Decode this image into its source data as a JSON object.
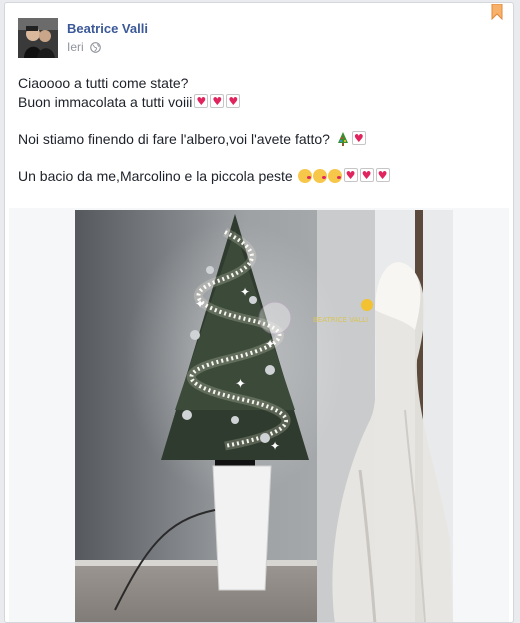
{
  "post": {
    "author": "Beatrice Valli",
    "timestamp": "Ieri",
    "lines": [
      "Ciaoooo a tutti come state?",
      "Buon immacolata a tutti voiii",
      "Noi stiamo finendo di fare l'albero,voi l'avete fatto?",
      "Un bacio da me,Marcolino e la piccola peste"
    ],
    "photo_watermark": "BEATRICE VALLI"
  },
  "colors": {
    "author_link": "#3b5998",
    "bookmark": "#f0a35b"
  },
  "icons": {
    "bookmark": "bookmark-icon",
    "audience": "globe-icon",
    "heart": "heart-emoji-icon",
    "kiss": "kiss-emoji-icon",
    "tree": "christmas-tree-emoji-icon"
  }
}
